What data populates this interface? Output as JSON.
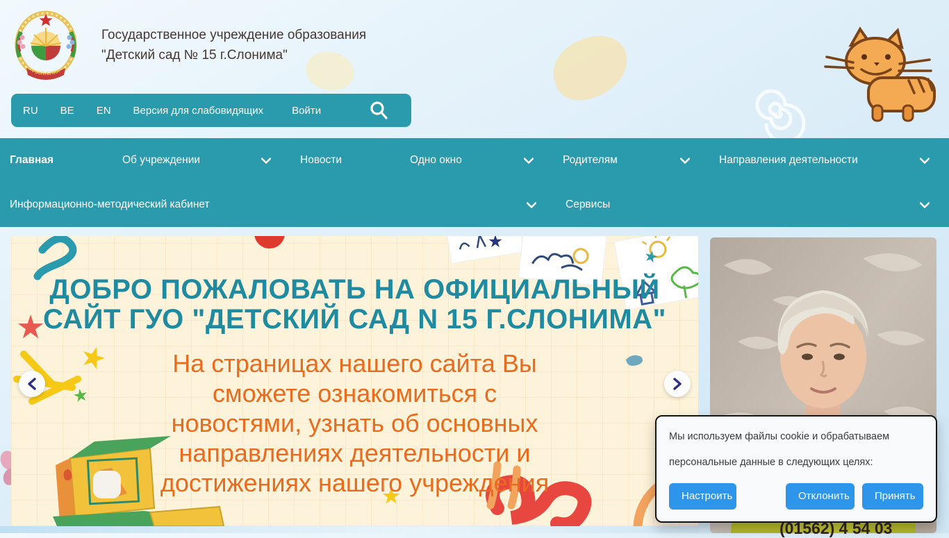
{
  "header": {
    "title_line1": "Государственное учреждение образования",
    "title_line2": "\"Детский сад № 15 г.Слонима\"",
    "logo_ribbon_text": "РЭСПУБЛІКА БЕЛАРУСЬ"
  },
  "utility_bar": {
    "lang_ru": "RU",
    "lang_be": "BE",
    "lang_en": "EN",
    "accessibility_label": "Версия для слабовидящих",
    "login_label": "Войти"
  },
  "nav": {
    "items_row1": [
      {
        "label": "Главная",
        "dropdown": false
      },
      {
        "label": "Об учреждении",
        "dropdown": true
      },
      {
        "label": "Новости",
        "dropdown": false
      },
      {
        "label": "Одно окно",
        "dropdown": true
      },
      {
        "label": "Родителям",
        "dropdown": true
      },
      {
        "label": "Направления деятельности",
        "dropdown": true
      }
    ],
    "items_row2": [
      {
        "label": "Информационно-методический кабинет",
        "dropdown": true
      },
      {
        "label": "Сервисы",
        "dropdown": true
      }
    ]
  },
  "hero": {
    "title_lines": [
      "ДОБРО ПОЖАЛОВАТЬ НА ОФИЦИАЛЬНЫЙ",
      "САЙТ ГУО \"ДЕТСКИЙ САД N 15 Г.СЛОНИМА\""
    ],
    "subtitle_lines": [
      "На страницах нашего сайта Вы",
      "сможете ознакомиться с",
      "новостями,  узнать об основных",
      "направлениях деятельности и",
      "достижениях нашего учреждения"
    ]
  },
  "cookie_banner": {
    "message_line1": "Мы используем файлы cookie и обрабатываем",
    "message_line2": "персональные данные в следующих целях:",
    "configure_label": "Настроить",
    "decline_label": "Отклонить",
    "accept_label": "Принять"
  },
  "contact": {
    "phone_partial": "(01562) 4 54 03"
  },
  "colors": {
    "teal_bar": "#2a9aad",
    "hero_title_teal": "#1f8ba0",
    "hero_text_orange": "#e96b1e",
    "cookie_button_blue": "#2e96ea",
    "hero_bg_cream": "#fdf3da",
    "header_text_brown": "#463730"
  }
}
